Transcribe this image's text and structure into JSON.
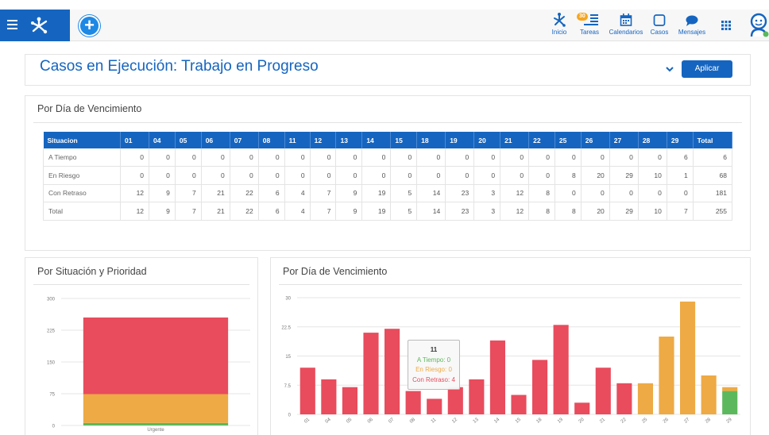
{
  "topbar": {
    "nav": [
      {
        "label": "Inicio",
        "icon": "home-network-icon"
      },
      {
        "label": "Tareas",
        "icon": "tasks-icon",
        "badge": "30"
      },
      {
        "label": "Calendarios",
        "icon": "calendar-icon"
      },
      {
        "label": "Casos",
        "icon": "cases-icon"
      },
      {
        "label": "Mensajes",
        "icon": "messages-icon"
      }
    ]
  },
  "header": {
    "title": "Casos en Ejecución: Trabajo en Progreso",
    "apply_label": "Aplicar"
  },
  "table_panel": {
    "title": "Por Día de Vencimiento",
    "columns": [
      "Situacion",
      "01",
      "04",
      "05",
      "06",
      "07",
      "08",
      "11",
      "12",
      "13",
      "14",
      "15",
      "18",
      "19",
      "20",
      "21",
      "22",
      "25",
      "26",
      "27",
      "28",
      "29",
      "Total"
    ],
    "rows": [
      {
        "label": "A Tiempo",
        "values": [
          "0",
          "0",
          "0",
          "0",
          "0",
          "0",
          "0",
          "0",
          "0",
          "0",
          "0",
          "0",
          "0",
          "0",
          "0",
          "0",
          "0",
          "0",
          "0",
          "0",
          "6",
          "6"
        ]
      },
      {
        "label": "En Riesgo",
        "values": [
          "0",
          "0",
          "0",
          "0",
          "0",
          "0",
          "0",
          "0",
          "0",
          "0",
          "0",
          "0",
          "0",
          "0",
          "0",
          "0",
          "8",
          "20",
          "29",
          "10",
          "1",
          "68"
        ]
      },
      {
        "label": "Con Retraso",
        "values": [
          "12",
          "9",
          "7",
          "21",
          "22",
          "6",
          "4",
          "7",
          "9",
          "19",
          "5",
          "14",
          "23",
          "3",
          "12",
          "8",
          "0",
          "0",
          "0",
          "0",
          "0",
          "181"
        ]
      },
      {
        "label": "Total",
        "values": [
          "12",
          "9",
          "7",
          "21",
          "22",
          "6",
          "4",
          "7",
          "9",
          "19",
          "5",
          "14",
          "23",
          "3",
          "12",
          "8",
          "8",
          "20",
          "29",
          "10",
          "7",
          "255"
        ]
      }
    ]
  },
  "colors": {
    "a_tiempo": "#5cb85c",
    "en_riesgo": "#eeaa44",
    "con_retraso": "#e84c5d",
    "primary": "#1565c0"
  },
  "left_chart": {
    "title": "Por Situación y Prioridad"
  },
  "right_chart": {
    "title": "Por Día de Vencimiento",
    "tooltip": {
      "title": "11",
      "a_tiempo": "A Tiempo: 0",
      "en_riesgo": "En Riesgo: 0",
      "con_retraso": "Con Retraso: 4"
    }
  },
  "chart_data": [
    {
      "type": "bar",
      "stacked": true,
      "categories": [
        "Urgente"
      ],
      "series": [
        {
          "name": "A Tiempo",
          "values": [
            6
          ]
        },
        {
          "name": "En Riesgo",
          "values": [
            68
          ]
        },
        {
          "name": "Con Retraso",
          "values": [
            181
          ]
        }
      ],
      "ylim": [
        0,
        300
      ],
      "yticks": [
        "0",
        "75",
        "150",
        "225",
        "300"
      ],
      "grid": true
    },
    {
      "type": "bar",
      "stacked": true,
      "categories": [
        "01",
        "04",
        "05",
        "06",
        "07",
        "08",
        "11",
        "12",
        "13",
        "14",
        "15",
        "18",
        "19",
        "20",
        "21",
        "22",
        "25",
        "26",
        "27",
        "28",
        "29"
      ],
      "series": [
        {
          "name": "A Tiempo",
          "values": [
            0,
            0,
            0,
            0,
            0,
            0,
            0,
            0,
            0,
            0,
            0,
            0,
            0,
            0,
            0,
            0,
            0,
            0,
            0,
            0,
            6
          ]
        },
        {
          "name": "En Riesgo",
          "values": [
            0,
            0,
            0,
            0,
            0,
            0,
            0,
            0,
            0,
            0,
            0,
            0,
            0,
            0,
            0,
            0,
            8,
            20,
            29,
            10,
            1
          ]
        },
        {
          "name": "Con Retraso",
          "values": [
            12,
            9,
            7,
            21,
            22,
            6,
            4,
            7,
            9,
            19,
            5,
            14,
            23,
            3,
            12,
            8,
            0,
            0,
            0,
            0,
            0
          ]
        }
      ],
      "ylim": [
        0,
        30
      ],
      "yticks": [
        "0",
        "7.5",
        "15",
        "22.5",
        "30"
      ],
      "grid": true
    }
  ]
}
